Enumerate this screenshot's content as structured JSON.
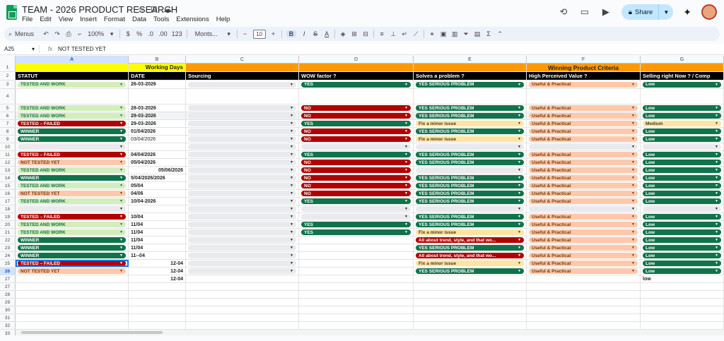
{
  "app": {
    "title": "TEAM - 2026 PRODUCT RESEARCH",
    "menus": [
      "File",
      "Edit",
      "View",
      "Insert",
      "Format",
      "Data",
      "Tools",
      "Extensions",
      "Help"
    ],
    "share_label": "Share"
  },
  "toolbar": {
    "menus_label": "Menus",
    "zoom": "100%",
    "currency": "$",
    "percent": "%",
    "dec_decrease": ".0",
    "dec_increase": ".00",
    "number_format": "123",
    "font": "Monts...",
    "font_size": "10",
    "minus": "−",
    "plus": "+",
    "bold": "B",
    "italic": "I",
    "strike": "S",
    "text_color": "A"
  },
  "formula_bar": {
    "cell_ref": "A25",
    "fx": "fx",
    "value": "NOT TESTED YET"
  },
  "columns": [
    "A",
    "B",
    "C",
    "D",
    "E",
    "F",
    "G"
  ],
  "colors": {
    "green_dark": "#11734b",
    "green_light": "#d4edbc",
    "red": "#b10202",
    "peach": "#ffcfc9",
    "amber": "#ffe5a0",
    "selection": "#1a73e8"
  },
  "headers": {
    "working_days": "Working Days",
    "winning_criteria": "Winning Product Criteria",
    "statut": "STATUT",
    "date": "DATE",
    "sourcing": "Sourcing",
    "wow": "WOW factor ?",
    "solves": "Solves a problem ?",
    "perceived": "High Perceived Value ?",
    "selling": "Selling right Now ? / Comp"
  },
  "rows": [
    {
      "n": "3",
      "statut": "TESTED AND WORK",
      "date": "26-03-2026",
      "src": true,
      "wow": "YES",
      "solves": "YES SERIOUS PROBLEM",
      "value": "Useful & Practical",
      "sell": "Low"
    },
    {
      "n": "4",
      "statut": "",
      "date": "",
      "src": false,
      "wow": "",
      "solves": "",
      "value": "",
      "sell": ""
    },
    {
      "n": "5",
      "statut": "TESTED AND WORK",
      "date": "28-03-2026",
      "src": true,
      "wow": "NO",
      "solves": "YES SERIOUS PROBLEM",
      "value": "Useful & Practical",
      "sell": "Low"
    },
    {
      "n": "5",
      "statut": "TESTED AND WORK",
      "date": "29-03-2026",
      "src": true,
      "wow": "NO",
      "solves": "YES SERIOUS PROBLEM",
      "value": "Useful & Practical",
      "sell": "Low"
    },
    {
      "n": "6",
      "statut": "TESTED – FAILED",
      "date": "29-03-2026",
      "src": true,
      "wow": "YES",
      "solves": "Fix a minor issue",
      "value": "Useful & Practical",
      "sell": "Medium"
    },
    {
      "n": "7",
      "statut": "WINNER",
      "date": "01/04/2026",
      "src": true,
      "wow": "NO",
      "solves": "YES SERIOUS PROBLEM",
      "value": "Useful & Practical",
      "sell": "Low"
    },
    {
      "n": "8",
      "statut": "WINNER",
      "date": "03/04/2026",
      "src": true,
      "wow": "NO",
      "solves": "Fix a minor issue",
      "value": "Useful & Practical",
      "sell": "Low"
    },
    {
      "n": "9",
      "statut": "",
      "date": "",
      "src": true,
      "wow": "",
      "solves": "",
      "value": "",
      "sell": ""
    },
    {
      "n": "10",
      "statut": "TESTED – FAILED",
      "date": "04/04/2026",
      "src": true,
      "wow": "YES",
      "solves": "YES SERIOUS PROBLEM",
      "value": "Useful & Practical",
      "sell": "Low"
    },
    {
      "n": "11",
      "statut": "NOT TESTED YET",
      "date": "05/04/2026",
      "src": true,
      "wow": "NO",
      "solves": "YES SERIOUS PROBLEM",
      "value": "Useful & Practical",
      "sell": "Low"
    },
    {
      "n": "12",
      "statut": "TESTED AND WORK",
      "date": "05/06/2026",
      "src": true,
      "wow": "NO",
      "solves": "",
      "value": "Useful & Practical",
      "sell": "Low"
    },
    {
      "n": "13",
      "statut": "WINNER",
      "date": "5/04/2026/2026",
      "src": true,
      "wow": "NO",
      "solves": "YES SERIOUS PROBLEM",
      "value": "Useful & Practical",
      "sell": "Low"
    },
    {
      "n": "14",
      "statut": "TESTED AND WORK",
      "date": "05/04",
      "src": true,
      "wow": "NO",
      "solves": "YES SERIOUS PROBLEM",
      "value": "Useful & Practical",
      "sell": "Low"
    },
    {
      "n": "15",
      "statut": "NOT TESTED YET",
      "date": "04/06",
      "src": true,
      "wow": "NO",
      "solves": "YES SERIOUS PROBLEM",
      "value": "Useful & Practical",
      "sell": "Low"
    },
    {
      "n": "16",
      "statut": "TESTED AND WORK",
      "date": "10/04-2026",
      "src": true,
      "wow": "YES",
      "solves": "YES SERIOUS PROBLEM",
      "value": "Useful & Practical",
      "sell": "Low"
    },
    {
      "n": "17",
      "statut": "",
      "date": "",
      "src": true,
      "wow": "",
      "solves": "",
      "value": "",
      "sell": ""
    },
    {
      "n": "18",
      "statut": "TESTED – FAILED",
      "date": "10/04",
      "src": true,
      "wow": "",
      "solves": "YES SERIOUS PROBLEM",
      "value": "Useful & Practical",
      "sell": "Low"
    },
    {
      "n": "19",
      "statut": "TESTED AND WORK",
      "date": "11/04",
      "src": true,
      "wow": "YES",
      "solves": "YES SERIOUS PROBLEM",
      "value": "Useful & Practical",
      "sell": "Low"
    },
    {
      "n": "20",
      "statut": "TESTED AND WORK",
      "date": "11/04",
      "src": true,
      "wow": "YES",
      "solves": "Fix a minor issue",
      "value": "Useful & Practical",
      "sell": "Low"
    },
    {
      "n": "21",
      "statut": "WINNER",
      "date": "11/04",
      "src": true,
      "wow": "",
      "solves": "All about trend, style, and that wo...",
      "value": "Useful & Practical",
      "sell": "Low"
    },
    {
      "n": "22",
      "statut": "WINNER",
      "date": "11/04",
      "src": true,
      "wow": "",
      "solves": "YES SERIOUS PROBLEM",
      "value": "Useful & Practical",
      "sell": "Low"
    },
    {
      "n": "23",
      "statut": "WINNER",
      "date": "11--04",
      "src": true,
      "wow": "",
      "solves": "All about trend, style, and that wo...",
      "value": "Useful & Practical",
      "sell": "Low"
    },
    {
      "n": "24",
      "statut": "TESTED – FAILED",
      "date": "12-04",
      "src": true,
      "wow": "",
      "solves": "Fix a minor issue",
      "value": "Useful & Practical",
      "sell": "Low"
    },
    {
      "n": "25",
      "statut": "NOT TESTED YET",
      "date": "12-04",
      "src": true,
      "wow": "",
      "solves": "YES SERIOUS PROBLEM",
      "value": "Useful & Practical",
      "sell": "Low"
    },
    {
      "n": "26",
      "statut": "",
      "date": "12-04",
      "src": false,
      "wow": "",
      "solves": "",
      "value": "",
      "sell": "low"
    }
  ],
  "empty_rows": [
    "27",
    "28",
    "29",
    "30",
    "31",
    "32",
    "33"
  ]
}
